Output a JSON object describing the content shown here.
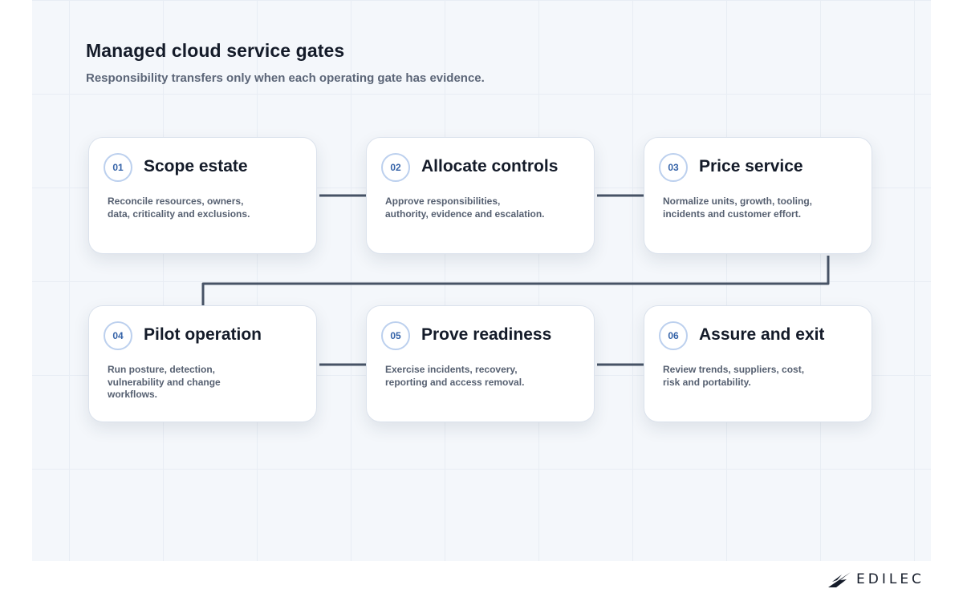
{
  "header": {
    "title": "Managed cloud service gates",
    "subtitle": "Responsibility transfers only when each operating gate has evidence."
  },
  "steps": [
    {
      "number": "01",
      "title": "Scope estate",
      "description": "Reconcile resources, owners, data, criticality and exclusions."
    },
    {
      "number": "02",
      "title": "Allocate controls",
      "description": "Approve responsibilities, authority, evidence and escalation."
    },
    {
      "number": "03",
      "title": "Price service",
      "description": "Normalize units, growth, tooling, incidents and customer effort."
    },
    {
      "number": "04",
      "title": "Pilot operation",
      "description": "Run posture, detection, vulnerability and change workflows."
    },
    {
      "number": "05",
      "title": "Prove readiness",
      "description": "Exercise incidents, recovery, reporting and access removal."
    },
    {
      "number": "06",
      "title": "Assure and exit",
      "description": "Review trends, suppliers, cost, risk and portability."
    }
  ],
  "brand": {
    "name": "EDILEC",
    "logo_icon": "bird-icon"
  },
  "colors": {
    "connector": "#475366",
    "badge_text": "#3563a8",
    "badge_border": "#bcd0ee"
  }
}
